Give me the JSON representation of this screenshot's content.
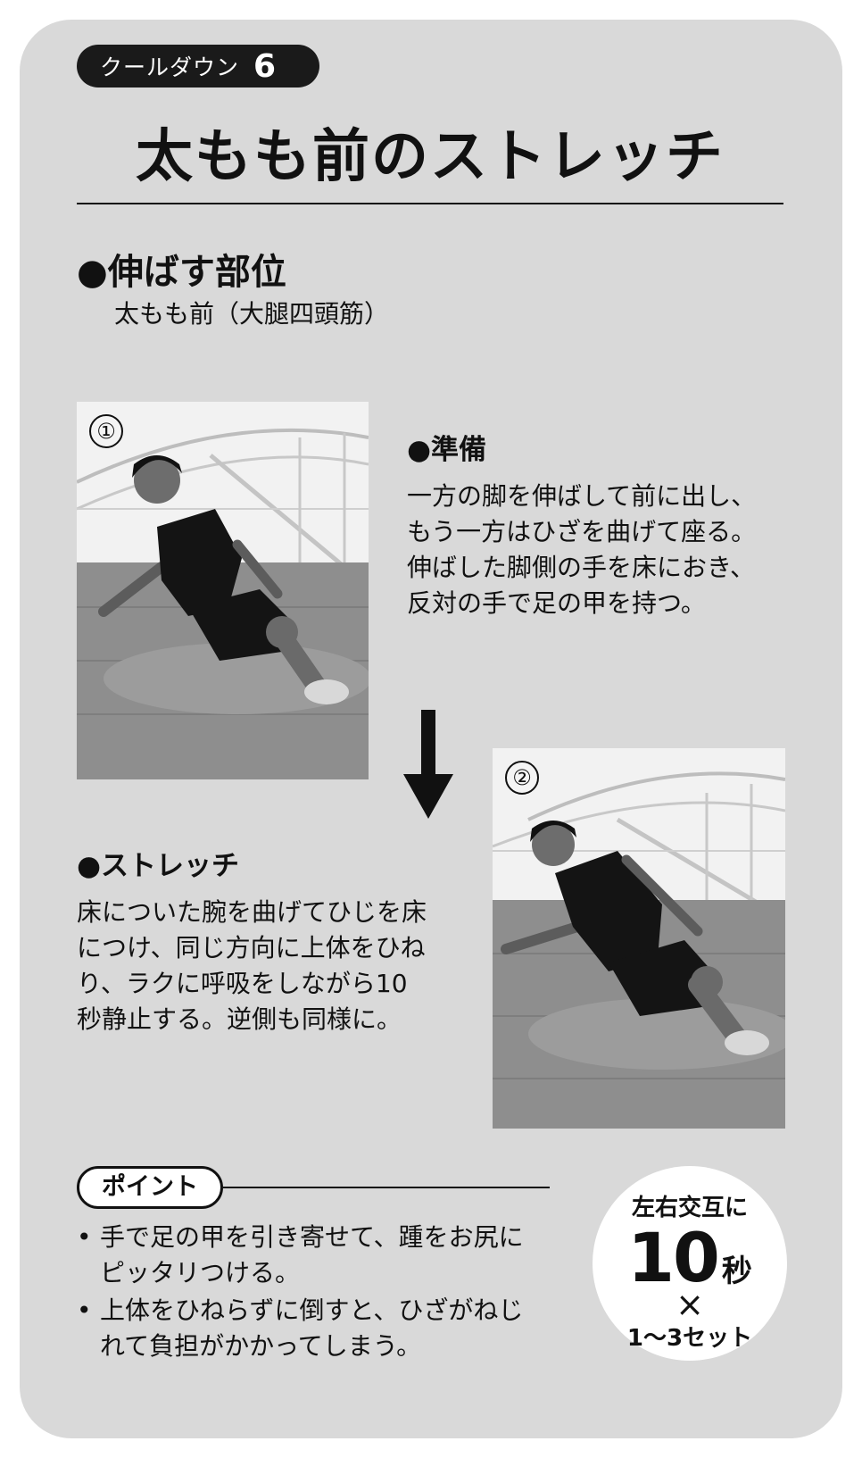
{
  "badge": {
    "label": "クールダウン",
    "number": "6"
  },
  "title": "太もも前のストレッチ",
  "target": {
    "heading": "●伸ばす部位",
    "text": "太もも前（大腿四頭筋）"
  },
  "steps": [
    {
      "marker": "①",
      "photo_icon": "person-sitting-photo",
      "heading": "●準備",
      "lines": [
        "一方の脚を伸ばして前に出し、",
        "もう一方はひざを曲げて座る。",
        "伸ばした脚側の手を床におき、",
        "反対の手で足の甲を持つ。"
      ]
    },
    {
      "marker": "②",
      "photo_icon": "person-stretching-photo",
      "heading": "●ストレッチ",
      "lines": [
        "床についた腕を曲げてひじを床",
        "につけ、同じ方向に上体をひね",
        "り、ラクに呼吸をしながら10",
        "秒静止する。逆側も同様に。"
      ]
    }
  ],
  "arrow_icon": "down-arrow-icon",
  "point": {
    "label": "ポイント",
    "items": [
      {
        "bullet": "•",
        "lines": [
          "手で足の甲を引き寄せて、踵をお尻に",
          "ピッタリつける。"
        ]
      },
      {
        "bullet": "•",
        "lines": [
          "上体をひねらずに倒すと、ひざがねじ",
          "れて負担がかかってしまう。"
        ]
      }
    ]
  },
  "reps": {
    "top": "左右交互に",
    "number": "10",
    "unit": "秒",
    "times": "×",
    "sets": "1〜3セット"
  }
}
